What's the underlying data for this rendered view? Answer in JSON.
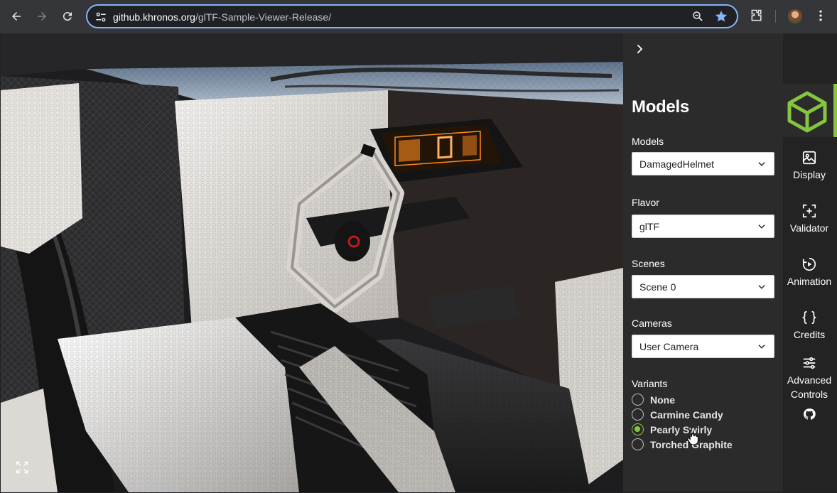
{
  "browser": {
    "url_host": "github.khronos.org",
    "url_path": "/glTF-Sample-Viewer-Release/",
    "icons": [
      "back-icon",
      "forward-icon",
      "reload-icon",
      "site-info-icon",
      "zoom-icon",
      "bookmark-star-icon",
      "extensions-icon",
      "profile-avatar",
      "kebab-menu-icon"
    ]
  },
  "panel": {
    "title": "Models",
    "models": {
      "label": "Models",
      "value": "DamagedHelmet"
    },
    "flavor": {
      "label": "Flavor",
      "value": "glTF"
    },
    "scenes": {
      "label": "Scenes",
      "value": "Scene 0"
    },
    "cameras": {
      "label": "Cameras",
      "value": "User Camera"
    },
    "variants": {
      "label": "Variants",
      "options": [
        "None",
        "Carmine Candy",
        "Pearly Swirly",
        "Torched Graphite"
      ],
      "selected": "Pearly Swirly"
    }
  },
  "rail": {
    "items": [
      {
        "label": "Display"
      },
      {
        "label": "Validator"
      },
      {
        "label": "Animation"
      },
      {
        "label": "Credits"
      },
      {
        "label_line1": "Advanced",
        "label_line2": "Controls"
      }
    ]
  },
  "colors": {
    "accent": "#86c540",
    "panel_bg": "#2b2b2b",
    "rail_bg": "#232323",
    "browser_bar": "#35363a",
    "omnibox_focus": "#8ab4f8",
    "dashboard_glow": "#ff8a1e"
  }
}
